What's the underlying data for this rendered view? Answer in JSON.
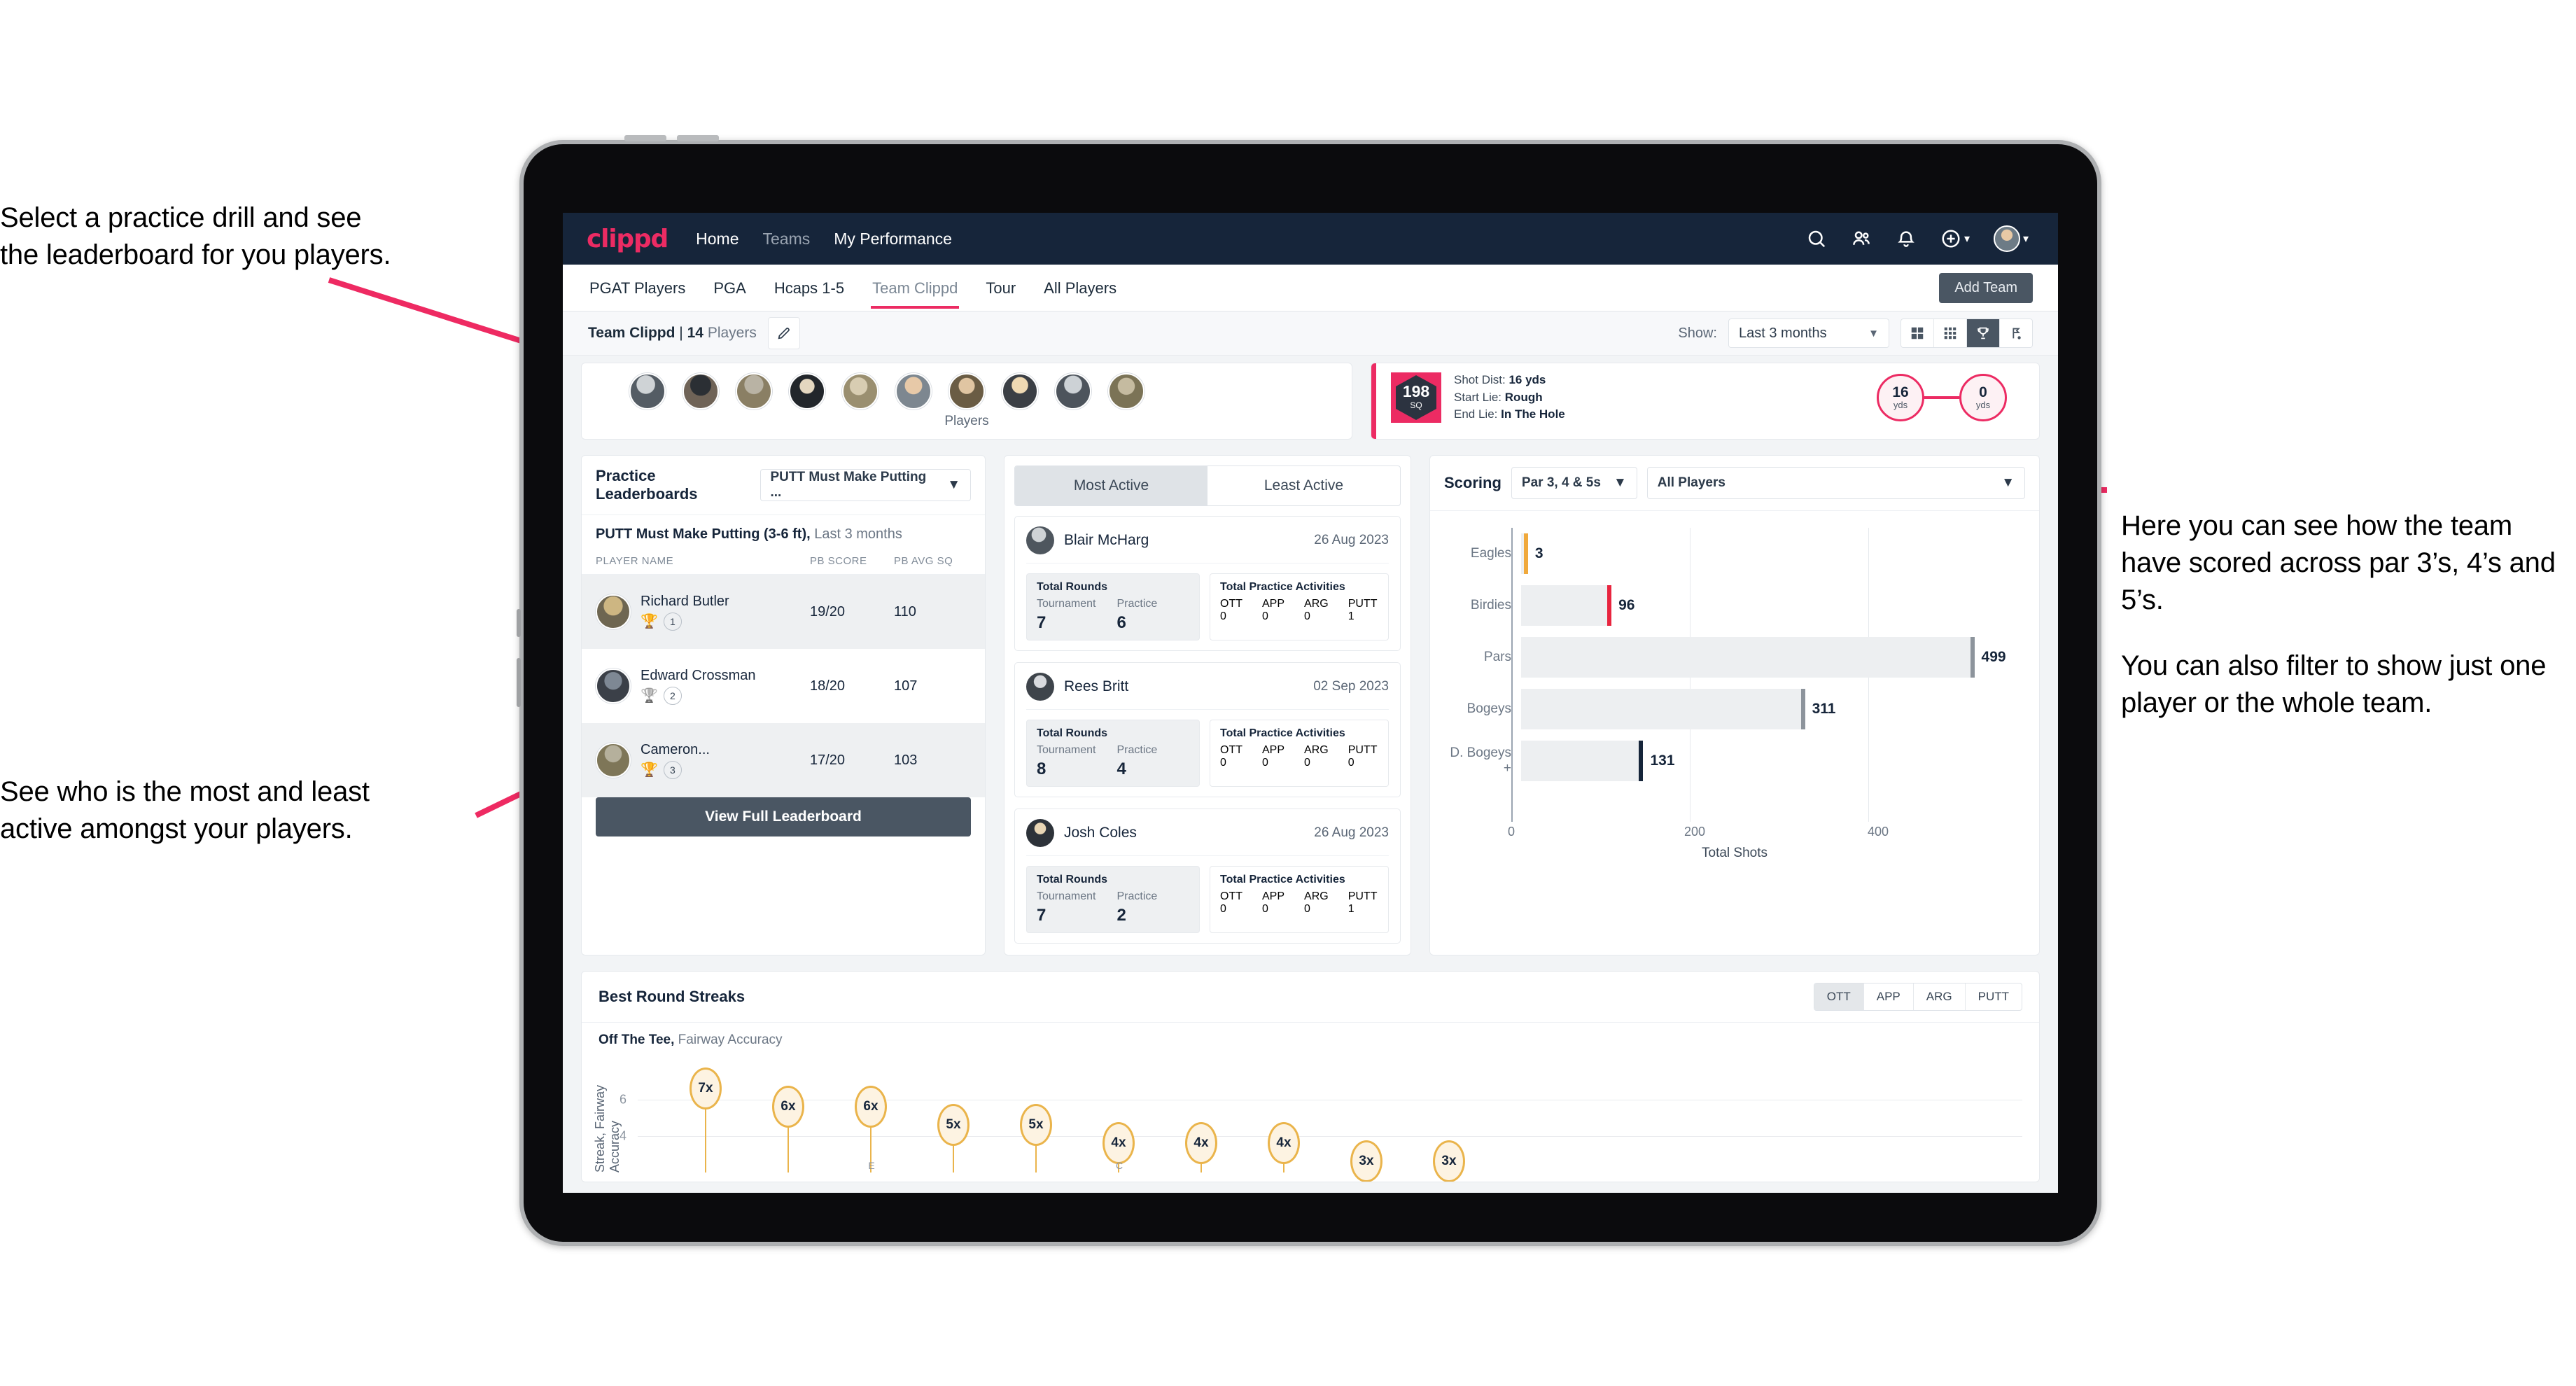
{
  "annotations": {
    "left_top": [
      "Select a practice drill and see",
      "the leaderboard for you players."
    ],
    "left_bottom": [
      "See who is the most and least",
      "active amongst your players."
    ],
    "right": [
      "Here you can see how the team have scored across par 3’s, 4’s and 5’s.",
      "You can also filter to show just one player or the whole team."
    ]
  },
  "app": {
    "logo": "clippd",
    "nav": [
      {
        "label": "Home",
        "active": true
      },
      {
        "label": "Teams",
        "active": false
      },
      {
        "label": "My Performance",
        "active": true
      }
    ],
    "icons": [
      "search-icon",
      "people-icon",
      "bell-icon",
      "plus-circle-icon",
      "avatar"
    ],
    "tabs": [
      {
        "label": "PGAT Players",
        "active": false
      },
      {
        "label": "PGA",
        "active": false
      },
      {
        "label": "Hcaps 1-5",
        "active": false
      },
      {
        "label": "Team Clippd",
        "active": true
      },
      {
        "label": "Tour",
        "active": false
      },
      {
        "label": "All Players",
        "active": false
      }
    ],
    "add_team": "Add Team"
  },
  "toolbar": {
    "team_name": "Team Clippd",
    "separator": "|",
    "player_count": "14",
    "players_word": "Players",
    "edit_icon": "pencil-icon",
    "show_label": "Show:",
    "show_value": "Last 3 months",
    "view_buttons": [
      "grid-large-icon",
      "grid-small-icon",
      "trophy-icon",
      "flag-icon"
    ],
    "active_view": "trophy-icon"
  },
  "players_strip": {
    "caption": "Players",
    "count": 10
  },
  "shot_card": {
    "sq_value": "198",
    "sq_unit": "SQ",
    "shot_dist_label": "Shot Dist:",
    "shot_dist_value": "16 yds",
    "start_lie_label": "Start Lie:",
    "start_lie_value": "Rough",
    "end_lie_label": "End Lie:",
    "end_lie_value": "In The Hole",
    "from_value": "16",
    "from_unit": "yds",
    "to_value": "0",
    "to_unit": "yds"
  },
  "leaderboard": {
    "title": "Practice Leaderboards",
    "drill_select": "PUTT Must Make Putting ...",
    "subtitle_bold": "PUTT Must Make Putting (3-6 ft),",
    "subtitle_dim": "Last 3 months",
    "columns": [
      "PLAYER NAME",
      "PB SCORE",
      "PB AVG SQ"
    ],
    "rows": [
      {
        "name": "Richard Butler",
        "rank": "1",
        "trophy": "gold",
        "pb_score": "19/20",
        "pb_avg_sq": "110"
      },
      {
        "name": "Edward Crossman",
        "rank": "2",
        "trophy": "silver",
        "pb_score": "18/20",
        "pb_avg_sq": "107"
      },
      {
        "name": "Cameron...",
        "rank": "3",
        "trophy": "bronze",
        "pb_score": "17/20",
        "pb_avg_sq": "103"
      }
    ],
    "view_full": "View Full Leaderboard"
  },
  "activity": {
    "tabs": [
      {
        "label": "Most Active",
        "active": true
      },
      {
        "label": "Least Active",
        "active": false
      }
    ],
    "total_rounds_label": "Total Rounds",
    "total_practice_label": "Total Practice Activities",
    "rounds_keys": [
      "Tournament",
      "Practice"
    ],
    "practice_keys": [
      "OTT",
      "APP",
      "ARG",
      "PUTT"
    ],
    "cards": [
      {
        "name": "Blair McHarg",
        "date": "26 Aug 2023",
        "tournament": "7",
        "practice": "6",
        "ott": "0",
        "app": "0",
        "arg": "0",
        "putt": "1"
      },
      {
        "name": "Rees Britt",
        "date": "02 Sep 2023",
        "tournament": "8",
        "practice": "4",
        "ott": "0",
        "app": "0",
        "arg": "0",
        "putt": "0"
      },
      {
        "name": "Josh Coles",
        "date": "26 Aug 2023",
        "tournament": "7",
        "practice": "2",
        "ott": "0",
        "app": "0",
        "arg": "0",
        "putt": "1"
      }
    ]
  },
  "scoring": {
    "title": "Scoring",
    "par_select": "Par 3, 4 & 5s",
    "player_select": "All Players"
  },
  "streaks": {
    "title": "Best Round Streaks",
    "metric_buttons": [
      "OTT",
      "APP",
      "ARG",
      "PUTT"
    ],
    "active_metric": "OTT",
    "subtitle_bold": "Off The Tee,",
    "subtitle_dim": "Fairway Accuracy"
  },
  "chart_data": [
    {
      "type": "bar",
      "orientation": "horizontal",
      "title": "Scoring",
      "categories": [
        "Eagles",
        "Birdies",
        "Pars",
        "Bogeys",
        "D. Bogeys +"
      ],
      "values": [
        3,
        96,
        499,
        311,
        131
      ],
      "bar_colors": [
        "#f0a93c",
        "#e8253f",
        "#8d949c",
        "#8d949c",
        "#16253a"
      ],
      "xlabel": "Total Shots",
      "ylabel": "",
      "xlim": [
        0,
        560
      ],
      "xticks": [
        0,
        200,
        400
      ],
      "grid": true,
      "legend": "none"
    },
    {
      "type": "lollipop",
      "title": "Best Round Streaks",
      "subtitle": "Off The Tee, Fairway Accuracy",
      "ylabel": "Streak, Fairway Accuracy",
      "yticks": [
        4,
        6
      ],
      "ylim": [
        0,
        8
      ],
      "values": [
        7,
        6,
        6,
        5,
        5,
        4,
        4,
        4,
        3,
        3
      ],
      "labels": [
        "7x",
        "6x",
        "6x",
        "5x",
        "5x",
        "4x",
        "4x",
        "4x",
        "3x",
        "3x"
      ],
      "marker_color": "#eab44b",
      "grid": true
    }
  ]
}
